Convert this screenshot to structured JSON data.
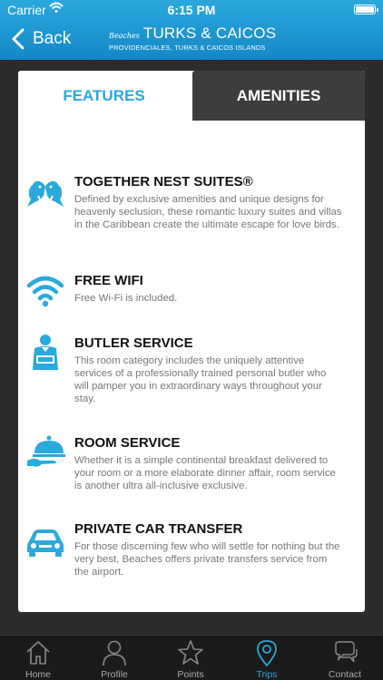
{
  "status": {
    "carrier": "Carrier",
    "time": "6:15 PM"
  },
  "header": {
    "back_label": "Back",
    "brand_script": "Beaches",
    "title": "TURKS & CAICOS",
    "subtitle": "PROVIDENCIALES, TURKS & CAICOS ISLANDS"
  },
  "tabs": {
    "features": "FEATURES",
    "amenities": "AMENITIES"
  },
  "features": [
    {
      "icon": "lovebirds-icon",
      "title": "TOGETHER NEST SUITES®",
      "description": "Defined by exclusive amenities and unique designs for heavenly seclusion, these romantic luxury suites and villas in the Caribbean create the ultimate escape for love birds."
    },
    {
      "icon": "wifi-icon",
      "title": "FREE WIFI",
      "description": "Free Wi-Fi is included."
    },
    {
      "icon": "butler-icon",
      "title": "BUTLER SERVICE",
      "description": "This room category includes the uniquely attentive services of a professionally trained personal butler who will pamper you in extraordinary ways throughout your stay."
    },
    {
      "icon": "cloche-icon",
      "title": "ROOM SERVICE",
      "description": "Whether it is a simple continental breakfast delivered to your room or a more elaborate dinner affair, room service is another ultra all-inclusive exclusive."
    },
    {
      "icon": "car-icon",
      "title": "PRIVATE CAR TRANSFER",
      "description": "For those discerning few who will settle for nothing but the very best, Beaches offers private transfers service from the airport."
    }
  ],
  "nav": [
    {
      "label": "Home",
      "icon": "home-icon"
    },
    {
      "label": "Profile",
      "icon": "profile-icon"
    },
    {
      "label": "Points",
      "icon": "star-icon"
    },
    {
      "label": "Trips",
      "icon": "location-pin-icon",
      "active": true
    },
    {
      "label": "Contact",
      "icon": "chat-icon"
    }
  ],
  "colors": {
    "accent": "#2aa9dd",
    "tab_inactive": "#3d3d3d",
    "background": "#2c2c2c",
    "tabbar": "#1b1b1b"
  }
}
